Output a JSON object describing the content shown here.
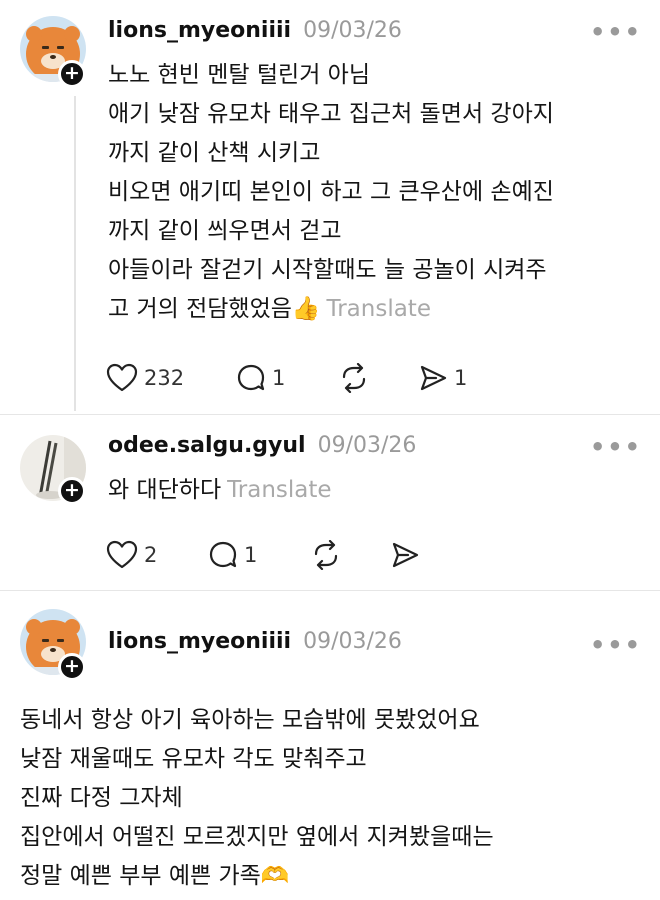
{
  "posts": [
    {
      "username": "lions_myeoniiii",
      "date": "09/03/26",
      "text": "노노 현빈 멘탈 털린거 아님\n애기 낮잠 유모차 태우고 집근처 돌면서 강아지\n까지 같이 산책 시키고\n비오면 애기띠 본인이 하고 그 큰우산에 손예진\n까지 같이 씌우면서 걷고\n아들이라 잘걷기 시작할때도 늘 공놀이 시켜주\n고 거의 전담했었음",
      "emoji": "👍",
      "translate": "Translate",
      "likes": "232",
      "comments": "1",
      "shares": "1"
    },
    {
      "username": "odee.salgu.gyul",
      "date": "09/03/26",
      "text": "와 대단하다",
      "translate": "Translate",
      "likes": "2",
      "comments": "1"
    },
    {
      "username": "lions_myeoniiii",
      "date": "09/03/26",
      "text": "동네서 항상 아기 육아하는 모습밖에 못봤었어요\n낮잠 재울때도 유모차 각도 맞춰주고\n진짜 다정 그자체\n집안에서 어떨진 모르겠지만 옆에서 지켜봤을때는\n정말 예쁜 부부 예쁜 가족",
      "emoji": "🫶"
    }
  ],
  "ui": {
    "more_glyph": "•••",
    "plus_glyph": "+"
  },
  "colors": {
    "avatar_orange": "#e8873a",
    "muted": "#9a9a9a"
  },
  "icons": [
    "heart-icon",
    "comment-icon",
    "repost-icon",
    "share-icon",
    "follow-plus-icon",
    "more-icon"
  ]
}
